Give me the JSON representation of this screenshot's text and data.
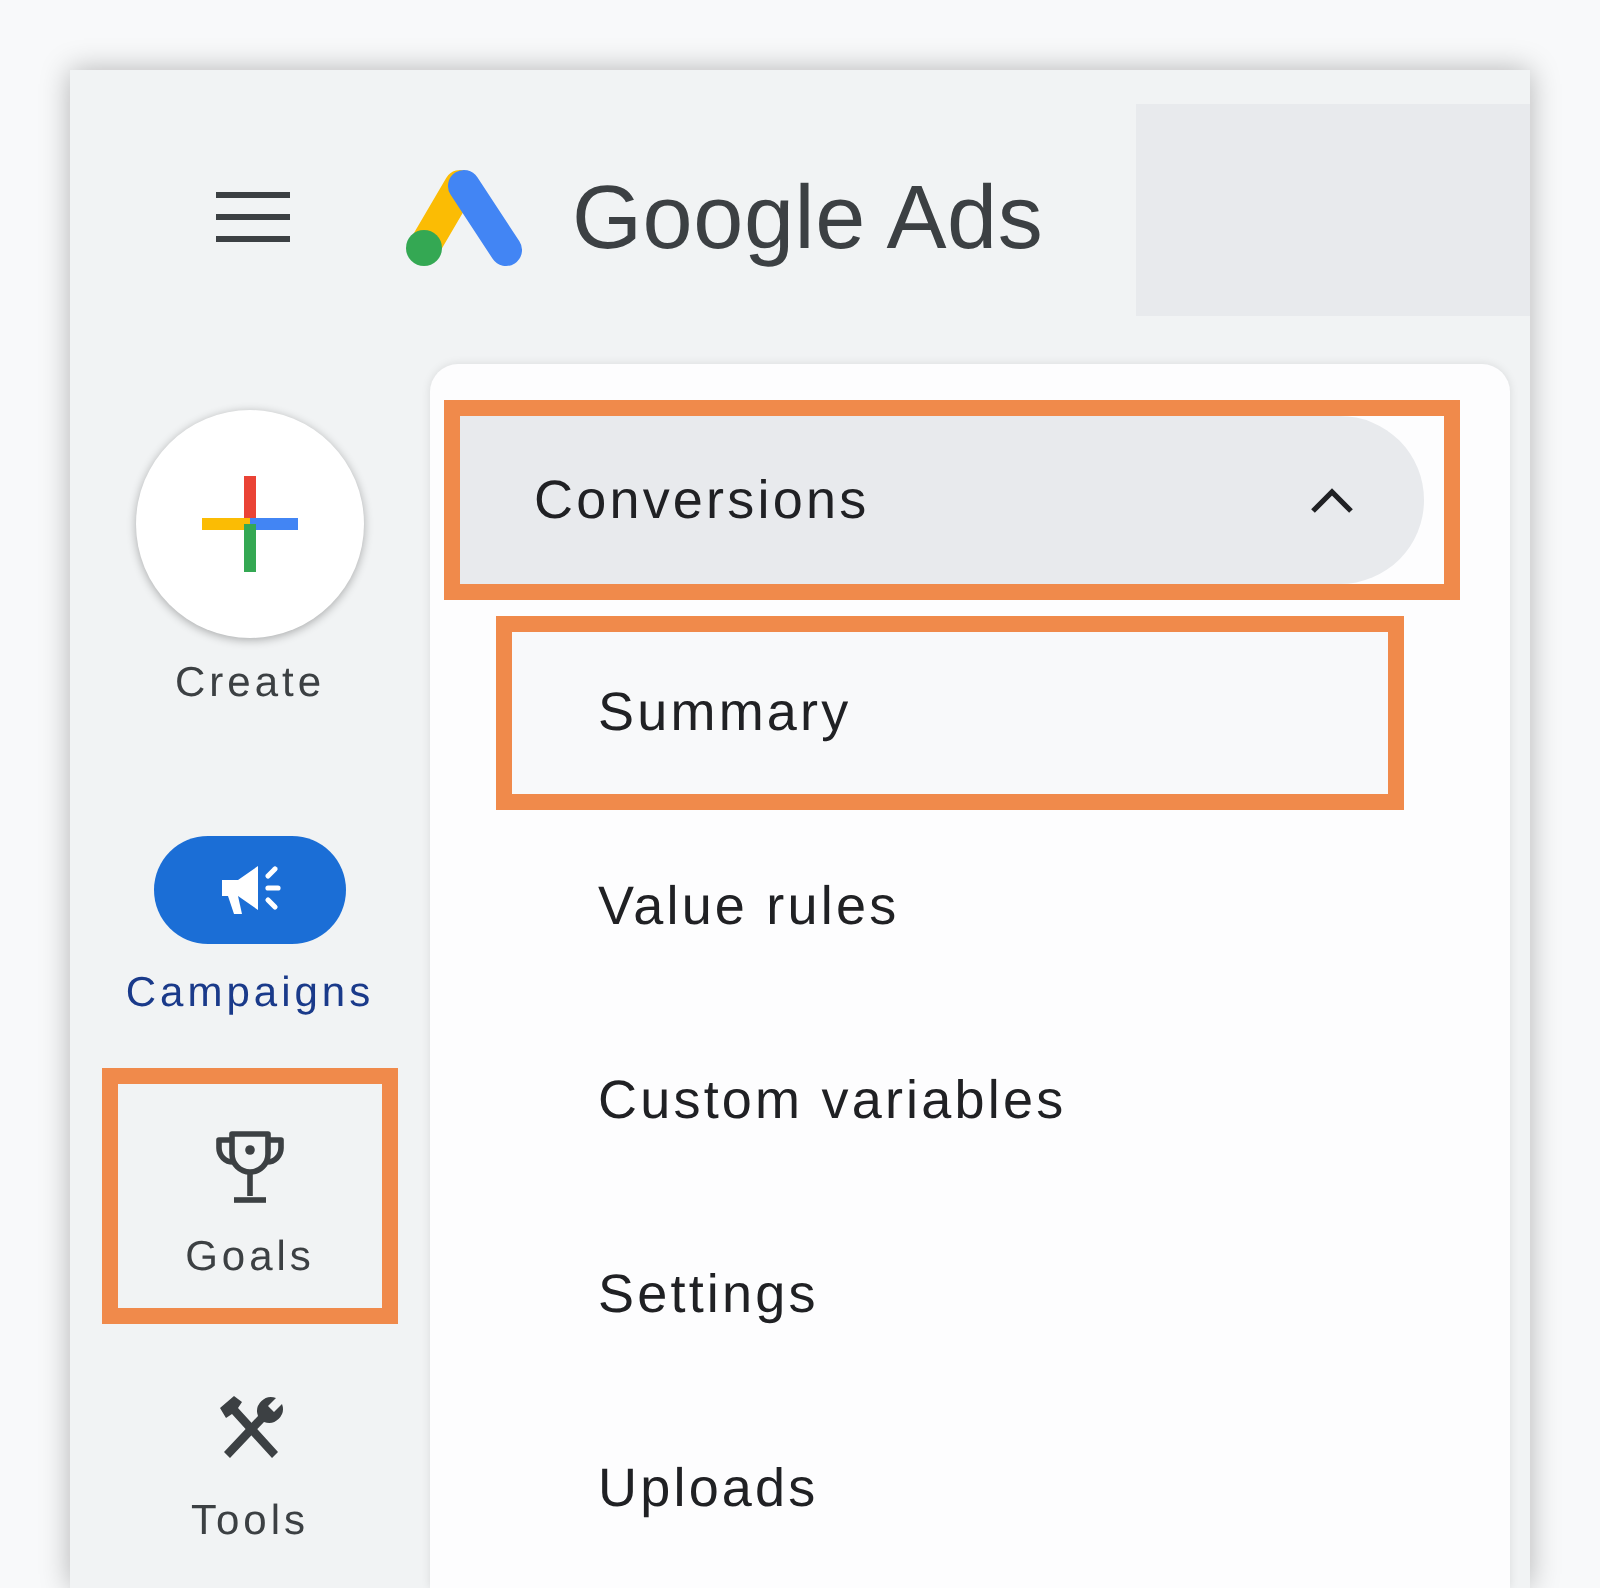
{
  "header": {
    "title": "Google Ads"
  },
  "rail": {
    "create": {
      "label": "Create"
    },
    "items": [
      {
        "label": "Campaigns",
        "selected": true,
        "highlighted": false
      },
      {
        "label": "Goals",
        "selected": false,
        "highlighted": true
      },
      {
        "label": "Tools",
        "selected": false,
        "highlighted": false
      }
    ]
  },
  "flyout": {
    "groups": [
      {
        "label": "Conversions",
        "expanded": true,
        "highlighted": true,
        "children": [
          {
            "label": "Summary",
            "highlighted": true
          },
          {
            "label": "Value rules",
            "highlighted": false
          },
          {
            "label": "Custom variables",
            "highlighted": false
          },
          {
            "label": "Settings",
            "highlighted": false
          },
          {
            "label": "Uploads",
            "highlighted": false
          }
        ]
      }
    ]
  }
}
